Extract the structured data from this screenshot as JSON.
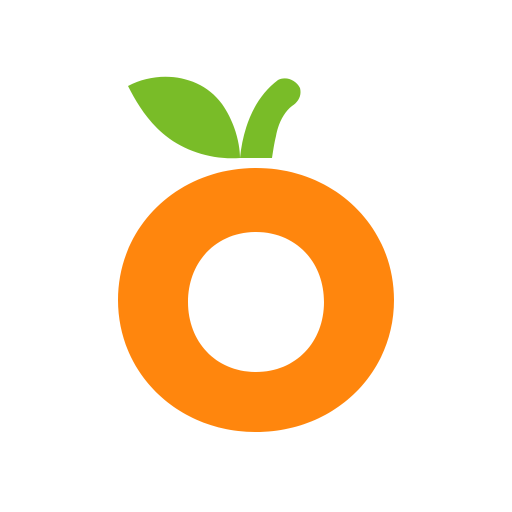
{
  "logo": {
    "icon": "orange-fruit-icon",
    "colors": {
      "background": "#ffffff",
      "fruit": "#FF860D",
      "leaf": "#79BC28",
      "center": "#ffffff"
    }
  }
}
